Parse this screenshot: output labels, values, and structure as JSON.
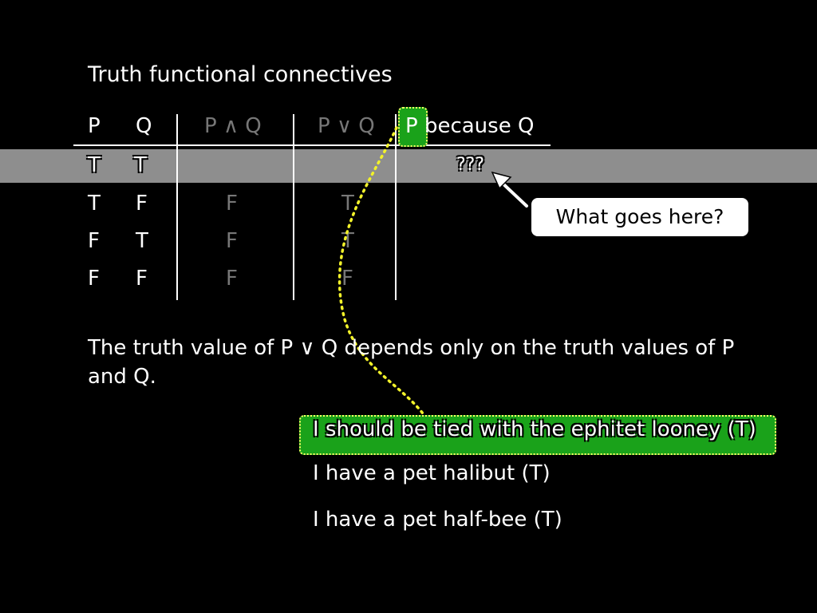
{
  "title": "Truth functional connectives",
  "headers": {
    "p": "P",
    "q": "Q",
    "and": "P ∧ Q",
    "or": "P ∨ Q",
    "because_p": "P",
    "because_rest": " because Q"
  },
  "rows": [
    {
      "p": "T",
      "q": "T",
      "and": "",
      "or": "",
      "because": "???"
    },
    {
      "p": "T",
      "q": "F",
      "and": "F",
      "or": "T",
      "because": ""
    },
    {
      "p": "F",
      "q": "T",
      "and": "F",
      "or": "T",
      "because": ""
    },
    {
      "p": "F",
      "q": "F",
      "and": "F",
      "or": "F",
      "because": ""
    }
  ],
  "callout": "What goes here?",
  "paragraph": "The truth value of P ∨ Q depends only on the truth values of P and Q.",
  "sentences": [
    "I should be tied with the ephitet looney (T)",
    "I have a pet halibut (T)",
    "I have a pet half-bee (T)"
  ]
}
